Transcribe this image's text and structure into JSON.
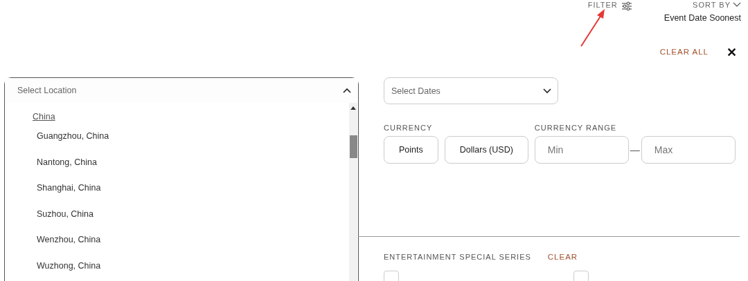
{
  "toolbar": {
    "filter_label": "FILTER",
    "sort_label": "SORT BY",
    "sort_value": "Event Date Soonest"
  },
  "annotation": {
    "kind": "arrow"
  },
  "clear_all": "CLEAR ALL",
  "close": "✕",
  "location": {
    "placeholder": "Select Location",
    "expanded": true,
    "groups": [
      {
        "label": "China",
        "children": [
          {
            "label": "Guangzhou, China"
          },
          {
            "label": "Nantong, China"
          },
          {
            "label": "Shanghai, China"
          },
          {
            "label": "Suzhou, China"
          },
          {
            "label": "Wenzhou, China"
          },
          {
            "label": "Wuzhong, China"
          }
        ]
      }
    ]
  },
  "dates": {
    "placeholder": "Select Dates",
    "expanded": false
  },
  "currency": {
    "label": "CURRENCY",
    "options": [
      {
        "label": "Points",
        "selected": false
      },
      {
        "label": "Dollars (USD)",
        "selected": false
      }
    ]
  },
  "currency_range": {
    "label": "CURRENCY RANGE",
    "min_placeholder": "Min",
    "separator": "—",
    "max_placeholder": "Max"
  },
  "special_series": {
    "label": "ENTERTAINMENT SPECIAL SERIES",
    "clear": "CLEAR",
    "options": [
      {
        "checked": false
      },
      {
        "checked": false
      }
    ]
  }
}
